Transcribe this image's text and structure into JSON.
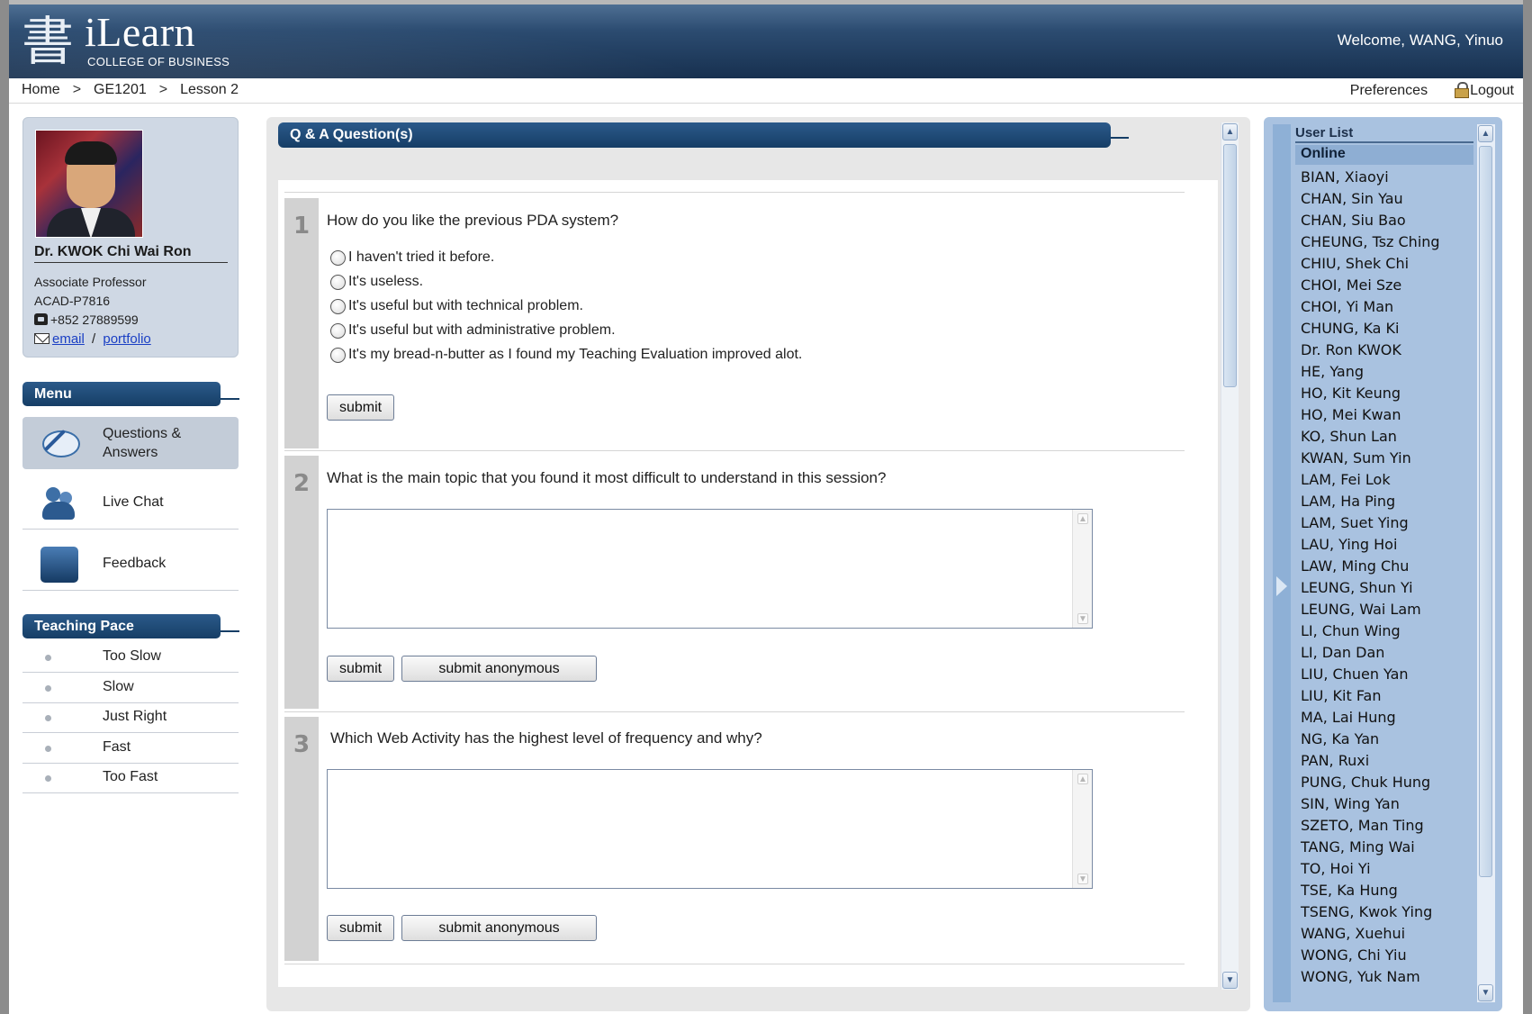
{
  "header": {
    "logo_glyph": "書",
    "logo_title": "iLearn",
    "logo_subtitle": "COLLEGE OF BUSINESS",
    "welcome_text": "Welcome, WANG, Yinuo"
  },
  "breadcrumb": {
    "items": [
      "Home",
      ">",
      "GE1201",
      ">",
      "Lesson 2"
    ]
  },
  "topnav": {
    "preferences": "Preferences",
    "logout": "Logout"
  },
  "profile": {
    "name": "Dr. KWOK Chi Wai Ron",
    "title": "Associate Professor",
    "room": "ACAD-P7816",
    "phone": "+852 27889599",
    "email_label": "email",
    "separator": "/",
    "portfolio_label": "portfolio"
  },
  "menu": {
    "heading": "Menu",
    "items": [
      {
        "label": "Questions & Answers",
        "icon": "qa-bubble-icon"
      },
      {
        "label": "Live Chat",
        "icon": "live-chat-icon"
      },
      {
        "label": "Feedback",
        "icon": "feedback-icon"
      }
    ]
  },
  "teaching_pace": {
    "heading": "Teaching Pace",
    "options": [
      "Too Slow",
      "Slow",
      "Just Right",
      "Fast",
      "Too Fast"
    ]
  },
  "qa": {
    "title": "Q & A Question(s)",
    "questions": [
      {
        "number": "1",
        "text": "How do you like the previous PDA system?",
        "options": [
          "I haven't tried it before.",
          "It's useless.",
          "It's useful but with technical problem.",
          "It's useful but with administrative problem.",
          "It's my bread-n-butter as I found my Teaching Evaluation improved alot."
        ],
        "submit_label": "submit"
      },
      {
        "number": "2",
        "text": "What is the main topic that you found it most difficult to understand in this session?",
        "answer_value": "",
        "submit_label": "submit",
        "submit_anon_label": "submit anonymous"
      },
      {
        "number": "3",
        "text": "Which Web Activity has the highest level of frequency and why?",
        "answer_value": "",
        "submit_label": "submit",
        "submit_anon_label": "submit anonymous"
      }
    ]
  },
  "user_list": {
    "title": "User List",
    "group": "Online",
    "users": [
      "BIAN, Xiaoyi",
      "CHAN, Sin Yau",
      "CHAN, Siu Bao",
      "CHEUNG, Tsz Ching",
      "CHIU, Shek Chi",
      "CHOI, Mei Sze",
      "CHOI, Yi Man",
      "CHUNG, Ka Ki",
      "Dr. Ron KWOK",
      "HE, Yang",
      "HO, Kit Keung",
      "HO, Mei Kwan",
      "KO, Shun Lan",
      "KWAN, Sum Yin",
      "LAM, Fei Lok",
      "LAM, Ha Ping",
      "LAM, Suet Ying",
      "LAU, Ying Hoi",
      "LAW, Ming Chu",
      "LEUNG, Shun Yi",
      "LEUNG, Wai Lam",
      "LI, Chun Wing",
      "LI, Dan Dan",
      "LIU, Chuen Yan",
      "LIU, Kit Fan",
      "MA, Lai Hung",
      "NG, Ka Yan",
      "PAN, Ruxi",
      "PUNG, Chuk Hung",
      "SIN, Wing Yan",
      "SZETO, Man Ting",
      "TANG, Ming Wai",
      "TO, Hoi Yi",
      "TSE, Ka Hung",
      "TSENG, Kwok Ying",
      "WANG, Xuehui",
      "WONG, Chi Yiu",
      "WONG, Yuk Nam"
    ]
  },
  "colors": {
    "header_dark": "#17304f",
    "section_bar": "#163e66",
    "user_panel": "#a9c2e0",
    "link": "#1a3fc4"
  }
}
